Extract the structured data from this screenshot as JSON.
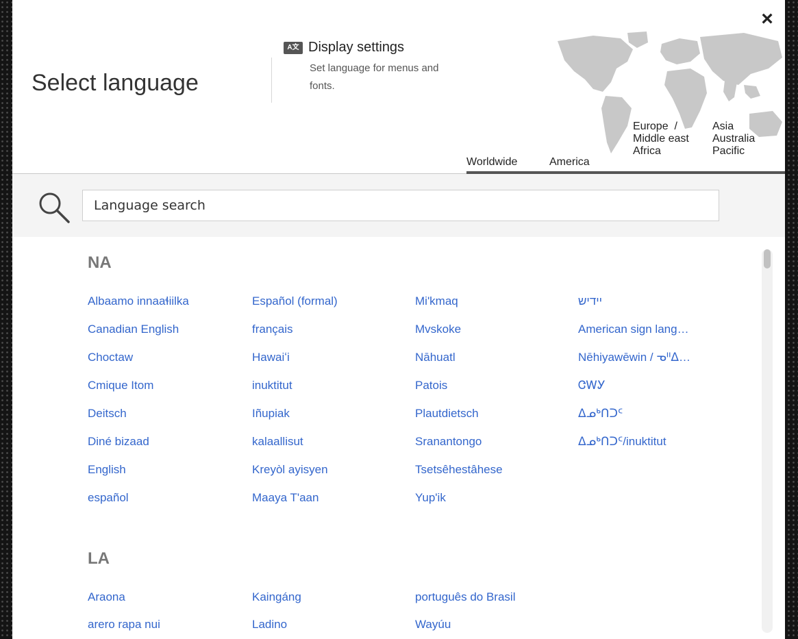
{
  "dialog": {
    "title": "Select language",
    "close_label": "×"
  },
  "display_settings": {
    "icon": "text-icon",
    "icon_glyph": "A文",
    "title": "Display settings",
    "description": "Set language for menus and fonts."
  },
  "regions": [
    {
      "label": "Worldwide"
    },
    {
      "label": "America"
    },
    {
      "label": "Europe  /\nMiddle east\nAfrica"
    },
    {
      "label": "Asia\nAustralia\nPacific"
    }
  ],
  "search": {
    "placeholder": "Language search",
    "icon": "search-icon"
  },
  "sections": [
    {
      "title": "NA",
      "columns": [
        [
          "Albaamo innaaɬiilka",
          "Canadian English",
          "Choctaw",
          "Cmique Itom",
          "Deitsch",
          "Diné bizaad",
          "English",
          "español"
        ],
        [
          "Español (formal)",
          "français",
          "Hawaiʻi",
          "inuktitut",
          "Iñupiak",
          "kalaallisut",
          "Kreyòl ayisyen",
          "Maaya T'aan"
        ],
        [
          "Mi'kmaq",
          "Mvskoke",
          "Nāhuatl",
          "Patois",
          "Plautdietsch",
          "Sranantongo",
          "Tsetsêhestâhese",
          "Yup'ik"
        ],
        [
          "יידיש",
          "American sign lang…",
          "Nēhiyawēwin / ᓀᐦᐃ…",
          "ᏣᎳᎩ",
          "ᐃᓄᒃᑎᑐᑦ",
          "ᐃᓄᒃᑎᑐᑦ/inuktitut"
        ]
      ]
    },
    {
      "title": "LA",
      "columns": [
        [
          "Araona",
          "arero rapa nui"
        ],
        [
          "Kaingáng",
          "Ladino"
        ],
        [
          "português do Brasil",
          "Wayúu"
        ]
      ]
    }
  ],
  "colors": {
    "link": "#3366cc",
    "section_title": "#777777",
    "map_land": "#c8c8c8"
  }
}
